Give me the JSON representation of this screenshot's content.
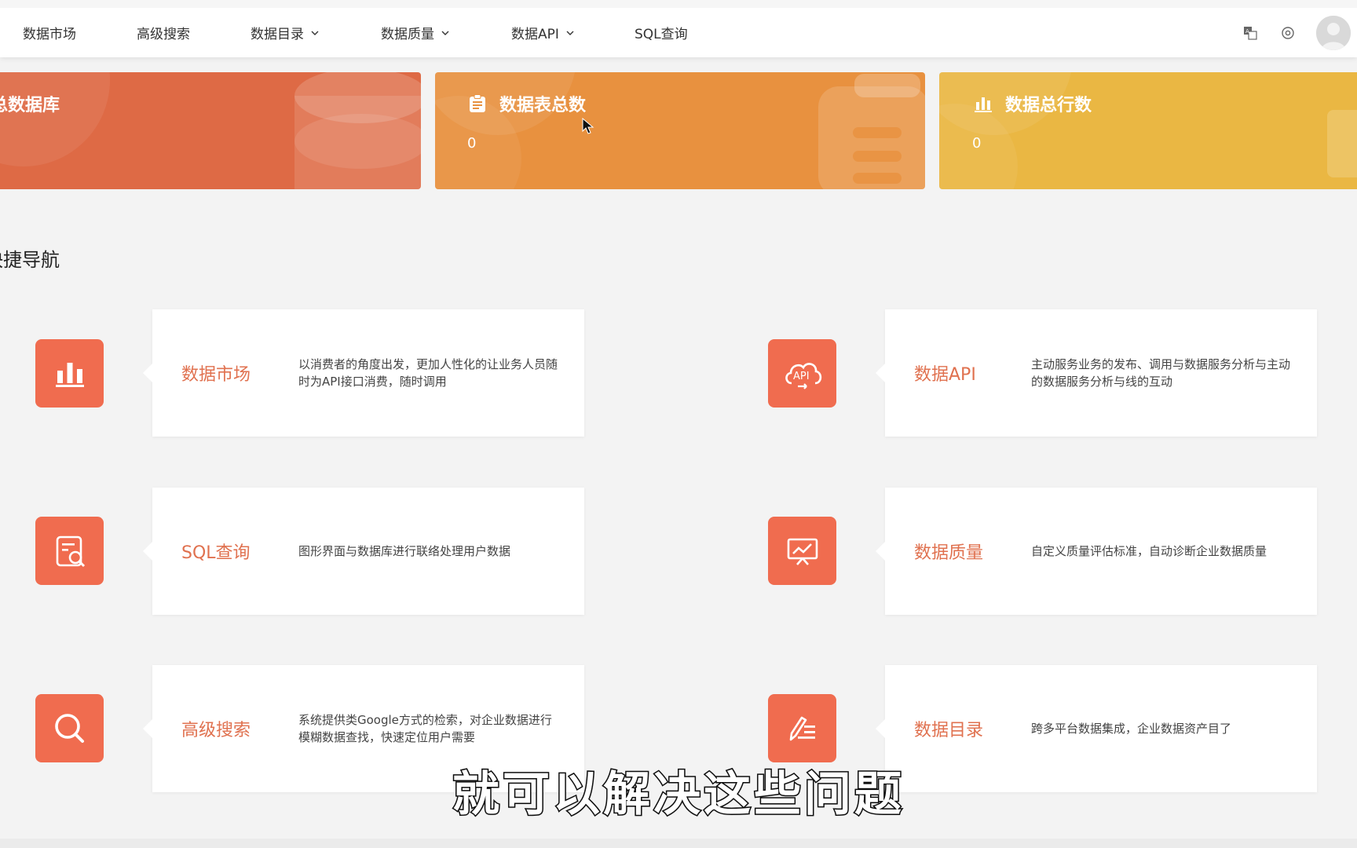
{
  "nav": {
    "items": [
      {
        "label": "数据市场",
        "dropdown": false
      },
      {
        "label": "高级搜索",
        "dropdown": false
      },
      {
        "label": "数据目录",
        "dropdown": true
      },
      {
        "label": "数据质量",
        "dropdown": true
      },
      {
        "label": "数据API",
        "dropdown": true
      },
      {
        "label": "SQL查询",
        "dropdown": false
      }
    ],
    "right_icons": [
      "translate-icon",
      "settings-icon",
      "avatar"
    ]
  },
  "stats": [
    {
      "title": "总数据库",
      "value": "",
      "color": "#de6a45",
      "icon": "database-icon"
    },
    {
      "title": "数据表总数",
      "value": "0",
      "color": "#e8913f",
      "icon": "clipboard-icon"
    },
    {
      "title": "数据总行数",
      "value": "0",
      "color": "#eab743",
      "icon": "bar-chart-icon"
    }
  ],
  "section": {
    "title": "快捷导航"
  },
  "quick_nav": [
    {
      "title": "数据市场",
      "desc": "以消费者的角度出发，更加人性化的让业务人员随时为API接口消费，随时调用",
      "icon": "bar-chart-icon"
    },
    {
      "title": "数据API",
      "desc": "主动服务业务的发布、调用与数据服务分析与主动的数据服务分析与线的互动",
      "icon": "api-cloud-icon"
    },
    {
      "title": "SQL查询",
      "desc": "图形界面与数据库进行联络处理用户数据",
      "icon": "document-search-icon"
    },
    {
      "title": "数据质量",
      "desc": "自定义质量评估标准，自动诊断企业数据质量",
      "icon": "presentation-chart-icon"
    },
    {
      "title": "高级搜索",
      "desc": "系统提供类Google方式的检索，对企业数据进行模糊数据查找，快速定位用户需要",
      "icon": "search-icon"
    },
    {
      "title": "数据目录",
      "desc": "跨多平台数据集成，企业数据资产目了",
      "icon": "edit-list-icon"
    }
  ],
  "subtitle": "就可以解决这些问题",
  "colors": {
    "accent": "#f06c4f",
    "title_accent": "#e0714f",
    "background": "#f3f3f3"
  }
}
